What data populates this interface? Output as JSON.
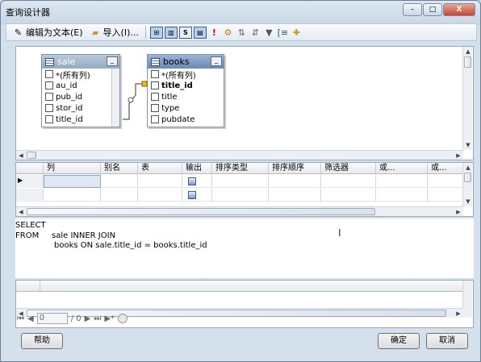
{
  "window": {
    "title": "查询设计器",
    "controls": [
      "–",
      "□",
      "X"
    ]
  },
  "toolbar": {
    "edit_as_text": "编辑为文本(E)",
    "import": "导入(I)..."
  },
  "diagram": {
    "tables": [
      {
        "name": "sale",
        "columns": [
          "*(所有列)",
          "au_id",
          "pub_id",
          "stor_id",
          "title_id"
        ]
      },
      {
        "name": "books",
        "columns": [
          "*(所有列)",
          "title_id",
          "title",
          "type",
          "pubdate"
        ]
      }
    ]
  },
  "grid": {
    "headers": [
      "列",
      "别名",
      "表",
      "输出",
      "排序类型",
      "排序顺序",
      "筛选器",
      "或...",
      "或..."
    ]
  },
  "sql": {
    "lines": [
      "SELECT",
      "FROM",
      "sale INNER JOIN",
      "books ON sale.title_id = books.title_id"
    ]
  },
  "navigation": {
    "current": "0",
    "total": "/ 0"
  },
  "buttons": {
    "help": "帮助",
    "ok": "确定",
    "cancel": "取消"
  },
  "colors": {
    "accent": "#6a88b4",
    "window_bg": "#cfdbe8"
  }
}
